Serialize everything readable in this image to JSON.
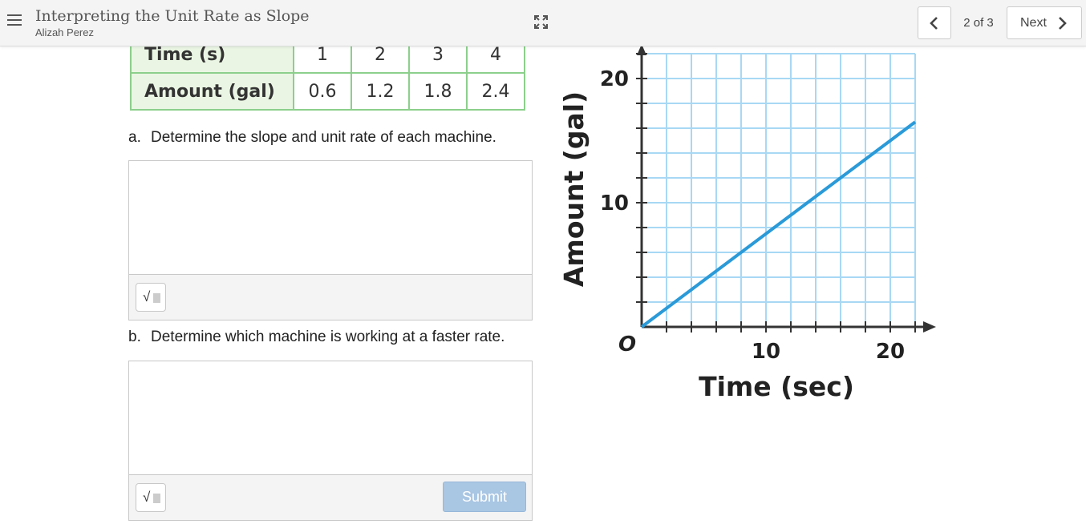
{
  "header": {
    "title": "Interpreting the Unit Rate as Slope",
    "author": "Alizah Perez",
    "page_indicator": "2 of 3",
    "next_label": "Next"
  },
  "table": {
    "rows": [
      {
        "label": "Time (s)",
        "values": [
          "1",
          "2",
          "3",
          "4"
        ]
      },
      {
        "label": "Amount (gal)",
        "values": [
          "0.6",
          "1.2",
          "1.8",
          "2.4"
        ]
      }
    ]
  },
  "questions": [
    {
      "label": "a.",
      "text": "Determine the slope and unit rate of each machine.",
      "answer": ""
    },
    {
      "label": "b.",
      "text": "Determine which machine is working at a faster rate.",
      "answer": ""
    }
  ],
  "math_button_symbol": "√",
  "submit_label": "Submit",
  "chart_data": {
    "type": "line",
    "xlabel": "Time (sec)",
    "ylabel": "Amount (gal)",
    "xlim": [
      0,
      22
    ],
    "ylim": [
      0,
      22
    ],
    "x_ticks": [
      "10",
      "20"
    ],
    "y_ticks": [
      "10",
      "20"
    ],
    "origin_label": "O",
    "grid": true,
    "series": [
      {
        "x": [
          0,
          22
        ],
        "y": [
          0,
          16.5
        ],
        "color": "#2a9ad8"
      }
    ]
  },
  "colors": {
    "grid": "#a8d8f4",
    "line": "#2a9ad8",
    "table_border": "#8ccf8c",
    "table_header_bg": "#eaf6e3",
    "submit_bg": "#a9c6e3"
  }
}
